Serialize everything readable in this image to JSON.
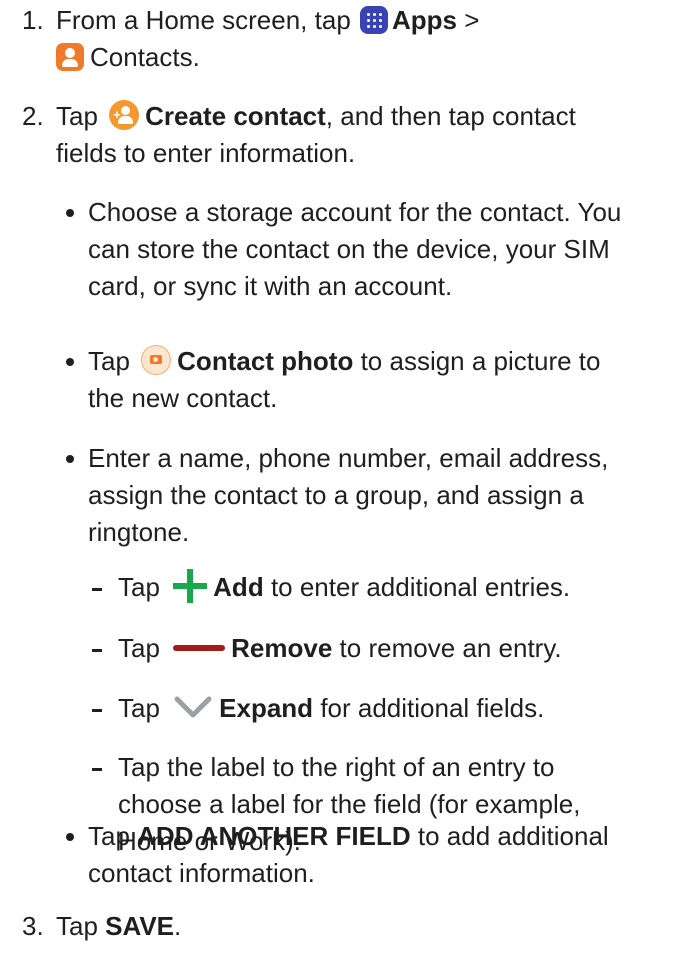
{
  "steps": [
    {
      "num": "1.",
      "before": "From a Home screen, tap",
      "apps": "Apps",
      "gt": ">",
      "contacts": "Contacts."
    },
    {
      "num": "2.",
      "before": "Tap",
      "create": "Create contact",
      "line1_after": ", and then tap contact",
      "line2": "fields to enter information."
    },
    {
      "num": "3.",
      "before": "Tap",
      "save": "SAVE",
      "after": "."
    }
  ],
  "bullets": [
    {
      "lines": [
        "Choose a storage account for the contact. You",
        "can store the contact on the device, your SIM",
        "card, or sync it with an account."
      ]
    },
    {
      "before": "Tap",
      "bold": "Contact photo",
      "after": "to assign a picture to",
      "line2": "the new contact."
    },
    {
      "lines": [
        "Enter a name, phone number, email address,",
        "assign the contact to a group, and assign a",
        "ringtone."
      ]
    },
    {
      "before": "Tap",
      "bold": "ADD ANOTHER FIELD",
      "after": "to add additional",
      "line2": "contact information."
    }
  ],
  "subs": [
    {
      "before": "Tap",
      "bold": "Add",
      "after": "to enter additional entries."
    },
    {
      "before": "Tap",
      "bold": "Remove",
      "after": "to remove an entry."
    },
    {
      "before": "Tap",
      "bold": "Expand",
      "after": "for additional fields."
    },
    {
      "lines": [
        "Tap the label to the right of an entry to",
        "choose a label for the field (for example,",
        "Home or Work)."
      ]
    }
  ],
  "icons": {
    "apps": "apps-grid-icon",
    "contacts": "contacts-app-icon",
    "create": "create-contact-icon",
    "camera": "camera-icon",
    "plus": "plus-icon",
    "minus": "minus-icon",
    "chevron": "chevron-down-icon"
  },
  "colors": {
    "apps": "#3a43b4",
    "contacts": "#f07a2a",
    "create": "#f3992e",
    "add": "#18a84a",
    "remove": "#a21c1c",
    "expand": "#9aa0a6"
  }
}
